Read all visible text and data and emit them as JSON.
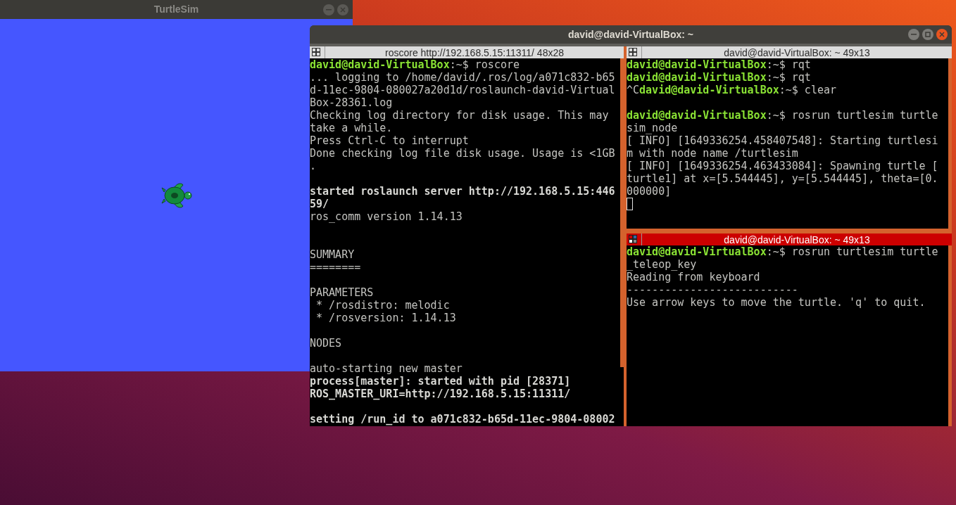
{
  "turtlesim": {
    "title": "TurtleSim",
    "focused": false
  },
  "terminator": {
    "title": "david@david-VirtualBox: ~",
    "focused": true,
    "panes": [
      {
        "title": "roscore http://192.168.5.15:11311/ 48x28",
        "focused": false,
        "lines": [
          {
            "kind": "prompt",
            "prompt": "david@david-VirtualBox",
            "text": ":~$ roscore"
          },
          {
            "kind": "output",
            "text": "... logging to /home/david/.ros/log/a071c832-b65"
          },
          {
            "kind": "output",
            "text": "d-11ec-9804-080027a20d1d/roslaunch-david-Virtual"
          },
          {
            "kind": "output",
            "text": "Box-28361.log"
          },
          {
            "kind": "output",
            "text": "Checking log directory for disk usage. This may"
          },
          {
            "kind": "output",
            "text": "take a while."
          },
          {
            "kind": "output",
            "text": "Press Ctrl-C to interrupt"
          },
          {
            "kind": "output",
            "text": "Done checking log file disk usage. Usage is <1GB"
          },
          {
            "kind": "output",
            "text": "."
          },
          {
            "kind": "blank"
          },
          {
            "kind": "bold",
            "text": "started roslaunch server http://192.168.5.15:446"
          },
          {
            "kind": "bold",
            "text": "59/"
          },
          {
            "kind": "output",
            "text": "ros_comm version 1.14.13"
          },
          {
            "kind": "blank"
          },
          {
            "kind": "blank"
          },
          {
            "kind": "output",
            "text": "SUMMARY"
          },
          {
            "kind": "output",
            "text": "========"
          },
          {
            "kind": "blank"
          },
          {
            "kind": "output",
            "text": "PARAMETERS"
          },
          {
            "kind": "output",
            "text": " * /rosdistro: melodic"
          },
          {
            "kind": "output",
            "text": " * /rosversion: 1.14.13"
          },
          {
            "kind": "blank"
          },
          {
            "kind": "output",
            "text": "NODES"
          },
          {
            "kind": "blank"
          },
          {
            "kind": "output",
            "text": "auto-starting new master"
          },
          {
            "kind": "bold",
            "text": "process[master]: started with pid [28371]"
          },
          {
            "kind": "bold",
            "text": "ROS_MASTER_URI=http://192.168.5.15:11311/"
          },
          {
            "kind": "blank"
          },
          {
            "kind": "bold",
            "text": "setting /run_id to a071c832-b65d-11ec-9804-08002"
          }
        ]
      },
      {
        "title": "david@david-VirtualBox: ~ 49x13",
        "focused": false,
        "lines": [
          {
            "kind": "prompt",
            "prompt": "david@david-VirtualBox",
            "text": ":~$ rqt"
          },
          {
            "kind": "prompt",
            "prompt": "david@david-VirtualBox",
            "text": ":~$ rqt"
          },
          {
            "kind": "prompt",
            "prefix": "^C",
            "prompt": "david@david-VirtualBox",
            "text": ":~$ clear"
          },
          {
            "kind": "blank"
          },
          {
            "kind": "prompt",
            "prompt": "david@david-VirtualBox",
            "text": ":~$ rosrun turtlesim turtle"
          },
          {
            "kind": "output",
            "text": "sim_node"
          },
          {
            "kind": "output",
            "text": "[ INFO] [1649336254.458407548]: Starting turtlesi"
          },
          {
            "kind": "output",
            "text": "m with node name /turtlesim"
          },
          {
            "kind": "output",
            "text": "[ INFO] [1649336254.463433084]: Spawning turtle ["
          },
          {
            "kind": "output",
            "text": "turtle1] at x=[5.544445], y=[5.544445], theta=[0."
          },
          {
            "kind": "output",
            "text": "000000]"
          },
          {
            "kind": "cursor"
          }
        ]
      },
      {
        "title": "david@david-VirtualBox: ~ 49x13",
        "focused": true,
        "lines": [
          {
            "kind": "prompt",
            "prompt": "david@david-VirtualBox",
            "text": ":~$ rosrun turtlesim turtle"
          },
          {
            "kind": "output",
            "text": "_teleop_key"
          },
          {
            "kind": "output",
            "text": "Reading from keyboard"
          },
          {
            "kind": "output",
            "text": "---------------------------"
          },
          {
            "kind": "output",
            "text": "Use arrow keys to move the turtle. 'q' to quit."
          }
        ]
      }
    ]
  }
}
